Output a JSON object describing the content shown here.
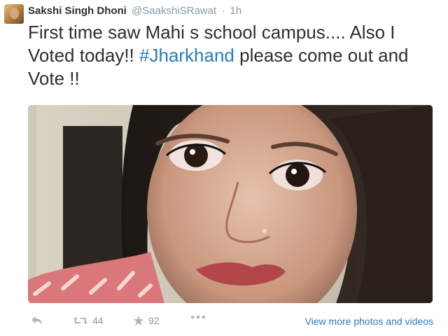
{
  "tweet": {
    "author_name": "Sakshi Singh Dhoni",
    "handle": "@SaakshiSRawat",
    "separator": "·",
    "time": "1h",
    "text_before": "First time saw Mahi s school campus.... Also I Voted today!! ",
    "hashtag": "#Jharkhand",
    "text_after": " please come out and Vote !!"
  },
  "actions": {
    "reply_icon": "reply-icon",
    "retweet_icon": "retweet-icon",
    "retweet_count": "44",
    "favorite_icon": "star-icon",
    "favorite_count": "92",
    "more_icon": "more-dots-icon",
    "view_more_label": "View more photos and videos"
  },
  "colors": {
    "link": "#2b7bb9",
    "muted": "#8899a6",
    "text": "#292f33"
  }
}
